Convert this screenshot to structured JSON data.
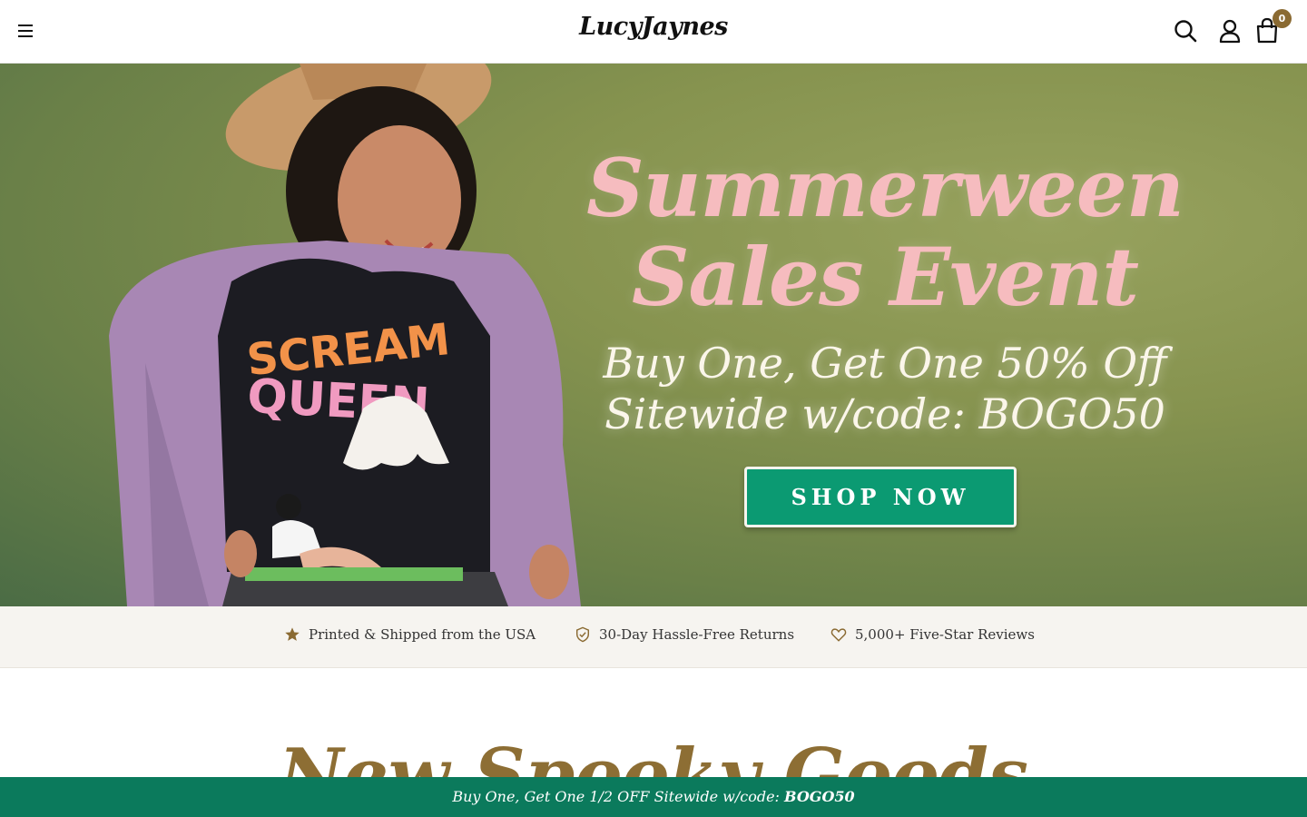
{
  "header": {
    "logo": "LucyJaynes",
    "cart_count": "0"
  },
  "hero": {
    "title_line1": "Summerween",
    "title_line2": "Sales Event",
    "subtitle_line1": "Buy One, Get One 50% Off",
    "subtitle_line2": "Sitewide w/code: BOGO50",
    "button_label": "SHOP NOW",
    "shirt_text_line1": "SCREAM",
    "shirt_text_line2": "QUEEN"
  },
  "trust": [
    {
      "icon": "star-icon",
      "label": "Printed & Shipped from the USA"
    },
    {
      "icon": "shield-check-icon",
      "label": "30-Day Hassle-Free Returns"
    },
    {
      "icon": "heart-icon",
      "label": "5,000+ Five-Star Reviews"
    }
  ],
  "section": {
    "title": "New Spooky Goods"
  },
  "promo_bar": {
    "text": "Buy One, Get One 1/2 OFF Sitewide w/code: ",
    "code": "BOGO50"
  },
  "colors": {
    "accent_gold": "#8d6e34",
    "promo_green": "#0b7a5c",
    "button_green": "#0b9a72",
    "hero_pink": "#f6bcbf"
  }
}
